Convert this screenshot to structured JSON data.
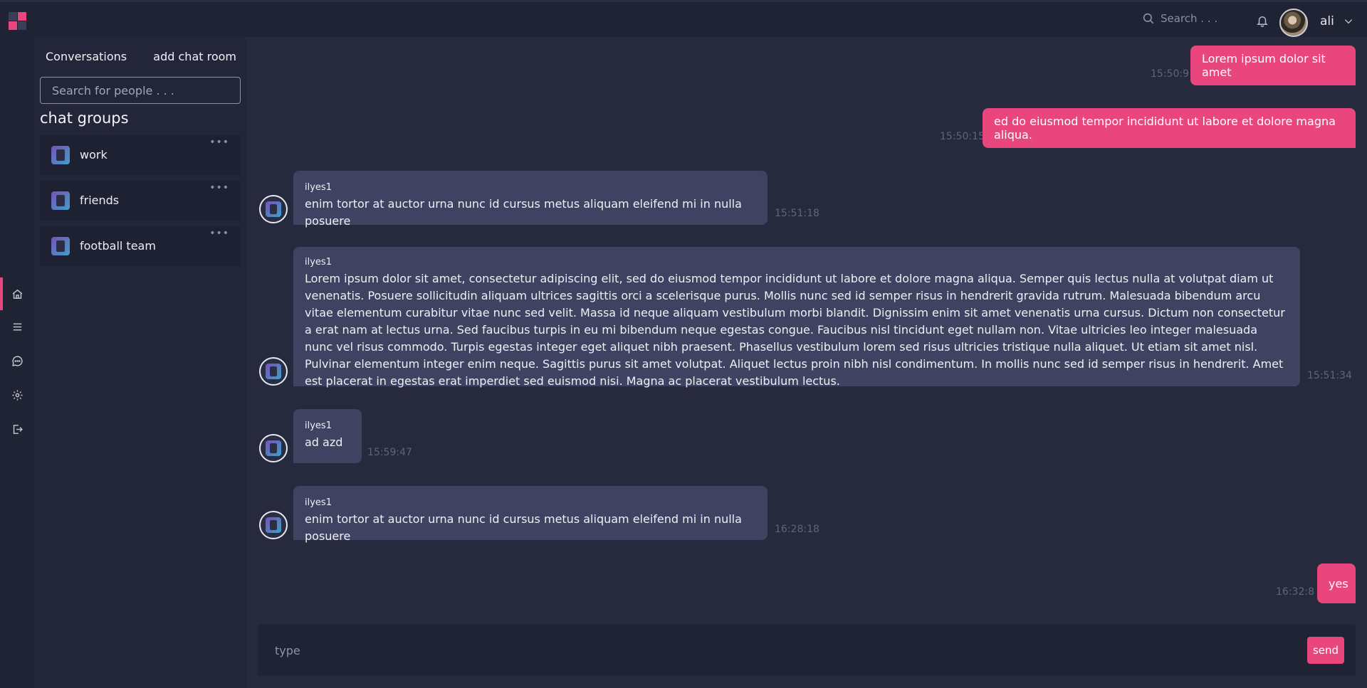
{
  "topbar": {
    "search_placeholder": "Search . . .",
    "user_name": "ali"
  },
  "rail": {
    "items": [
      {
        "icon": "home-icon",
        "active": true
      },
      {
        "icon": "menu-icon",
        "active": false
      },
      {
        "icon": "chat-icon",
        "active": false
      },
      {
        "icon": "gear-icon",
        "active": false
      },
      {
        "icon": "logout-icon",
        "active": false
      }
    ]
  },
  "panel": {
    "title": "Conversations",
    "add_room_label": "add chat room",
    "search_placeholder": "Search for people . . .",
    "groups_title": "chat groups",
    "groups": [
      {
        "name": "work"
      },
      {
        "name": "friends"
      },
      {
        "name": "football team"
      }
    ]
  },
  "messages": [
    {
      "direction": "out",
      "text": "Lorem ipsum dolor sit amet",
      "time": "15:50:9"
    },
    {
      "direction": "out",
      "text": "ed do eiusmod tempor incididunt ut labore et dolore magna aliqua.",
      "time": "15:50:15"
    },
    {
      "direction": "in",
      "sender": "ilyes1",
      "text": "enim tortor at auctor urna nunc id cursus metus aliquam eleifend mi in nulla posuere",
      "time": "15:51:18"
    },
    {
      "direction": "in",
      "sender": "ilyes1",
      "text": "Lorem ipsum dolor sit amet, consectetur adipiscing elit, sed do eiusmod tempor incididunt ut labore et dolore magna aliqua. Semper quis lectus nulla at volutpat diam ut venenatis. Posuere sollicitudin aliquam ultrices sagittis orci a scelerisque purus. Mollis nunc sed id semper risus in hendrerit gravida rutrum. Malesuada bibendum arcu vitae elementum curabitur vitae nunc sed velit. Massa id neque aliquam vestibulum morbi blandit. Dignissim enim sit amet venenatis urna cursus. Dictum non consectetur a erat nam at lectus urna. Sed faucibus turpis in eu mi bibendum neque egestas congue. Faucibus nisl tincidunt eget nullam non. Vitae ultricies leo integer malesuada nunc vel risus commodo. Turpis egestas integer eget aliquet nibh praesent. Phasellus vestibulum lorem sed risus ultricies tristique nulla aliquet. Ut etiam sit amet nisl. Pulvinar elementum integer enim neque. Sagittis purus sit amet volutpat. Aliquet lectus proin nibh nisl condimentum. In mollis nunc sed id semper risus in hendrerit. Amet est placerat in egestas erat imperdiet sed euismod nisi. Magna ac placerat vestibulum lectus.",
      "time": "15:51:34"
    },
    {
      "direction": "in",
      "sender": "ilyes1",
      "text": "ad azd",
      "time": "15:59:47"
    },
    {
      "direction": "in",
      "sender": "ilyes1",
      "text": "enim tortor at auctor urna nunc id cursus metus aliquam eleifend mi in nulla posuere",
      "time": "16:28:18"
    },
    {
      "direction": "out",
      "text": "yes",
      "time": "16:32:8"
    }
  ],
  "composer": {
    "placeholder": "type",
    "send_label": "send"
  },
  "colors": {
    "accent": "#e8467c",
    "background": "#262a3c",
    "panel": "#222638",
    "incoming_bubble": "#3f4361"
  }
}
